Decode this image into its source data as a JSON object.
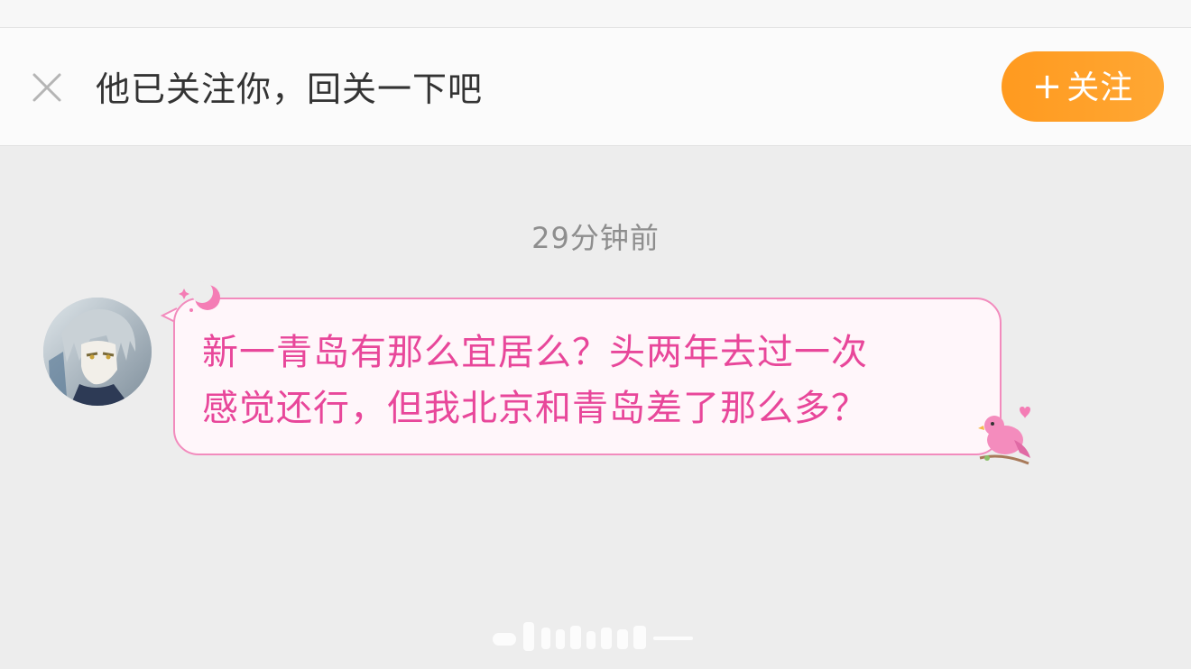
{
  "follow_bar": {
    "close_icon": "close-icon",
    "text": "他已关注你，回关一下吧",
    "follow_button": {
      "plus": "+",
      "label": "关注"
    },
    "button_color": "#ff9a1f"
  },
  "conversation": {
    "timestamp": "29分钟前",
    "messages": [
      {
        "sender_avatar": "anime-character-avatar",
        "lines": [
          "新一青岛有那么宜居么？头两年去过一次",
          "感觉还行，但我北京和青岛差了那么多？"
        ],
        "bubble_border_color": "#f28bbd",
        "text_color": "#e8479a",
        "decorations": [
          "moon-sparkle-icon",
          "pink-bird-icon"
        ]
      }
    ]
  },
  "colors": {
    "background": "#ededed",
    "bar_background": "#fbfbfb",
    "timestamp": "#8e8e8e"
  }
}
